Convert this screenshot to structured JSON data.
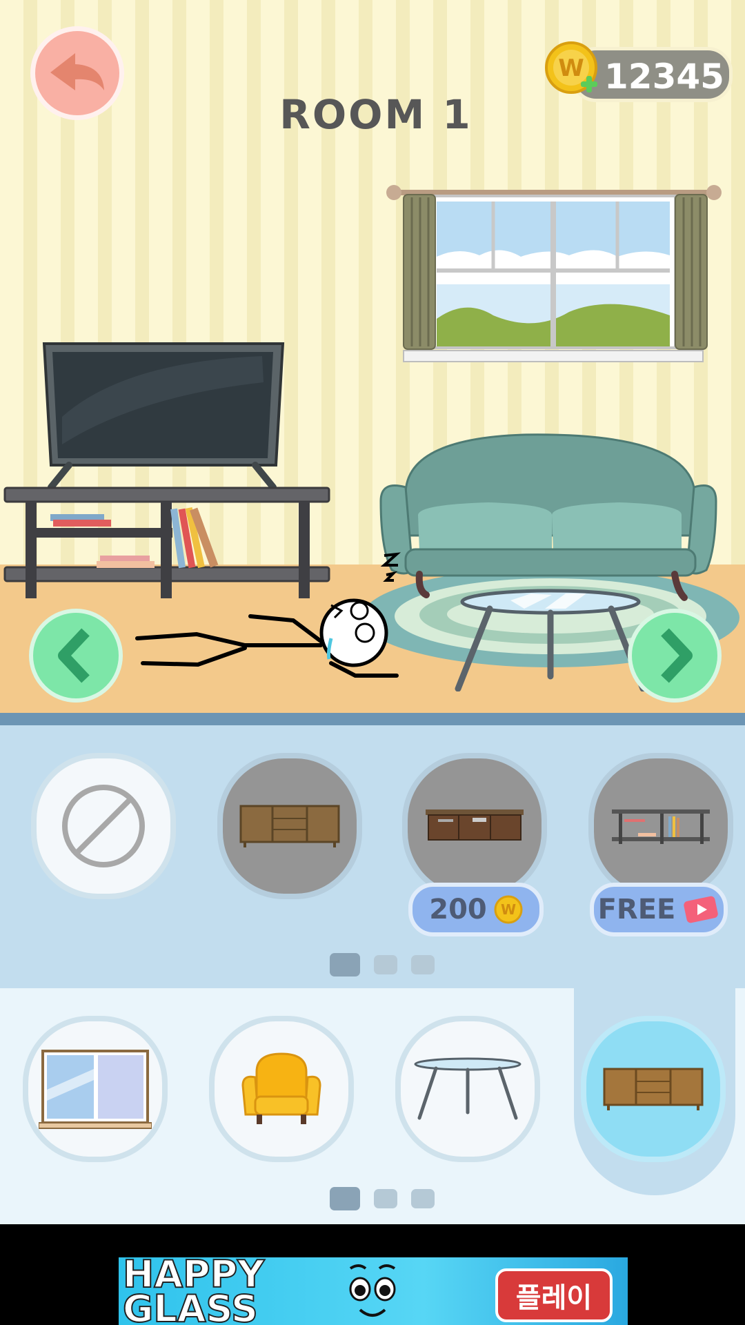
{
  "room": {
    "title": "ROOM 1"
  },
  "currency": {
    "coins": "12345",
    "coin_letter": "W"
  },
  "furniture_slots": [
    {
      "name": "none",
      "state": "light"
    },
    {
      "name": "wooden-sideboard",
      "state": "dark"
    },
    {
      "name": "tv-stand",
      "state": "dark",
      "price": "200"
    },
    {
      "name": "metal-shelf",
      "state": "dark",
      "price": "FREE"
    }
  ],
  "category_slots": [
    {
      "name": "window",
      "state": "light"
    },
    {
      "name": "armchair",
      "state": "light"
    },
    {
      "name": "coffee-table",
      "state": "light"
    },
    {
      "name": "sideboard",
      "state": "active"
    }
  ],
  "pager_top": {
    "pages": 3,
    "current": 1
  },
  "pager_bottom": {
    "pages": 3,
    "current": 1
  },
  "ad": {
    "headline_line1": "HAPPY",
    "headline_line2": "GLASS",
    "cta": "플레이"
  },
  "colors": {
    "coin": "#f3c21a",
    "price_button": "#8fb4ee",
    "nav_arrow": "#7de6a8",
    "back_button": "#f9b0a4"
  }
}
